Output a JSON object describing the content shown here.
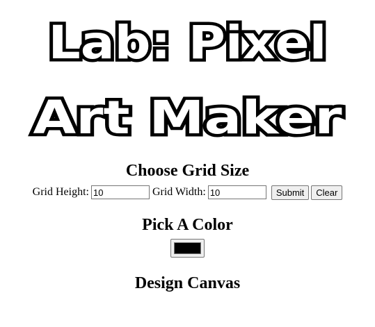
{
  "title": {
    "line1": "Lab: Pixel",
    "line2": "Art Maker"
  },
  "grid_section": {
    "heading": "Choose Grid Size",
    "height_label": "Grid Height:",
    "height_value": "10",
    "width_label": "Grid Width:",
    "width_value": "10",
    "submit_label": "Submit",
    "clear_label": "Clear"
  },
  "color_section": {
    "heading": "Pick A Color",
    "selected_color": "#000000"
  },
  "canvas_section": {
    "heading": "Design Canvas"
  }
}
